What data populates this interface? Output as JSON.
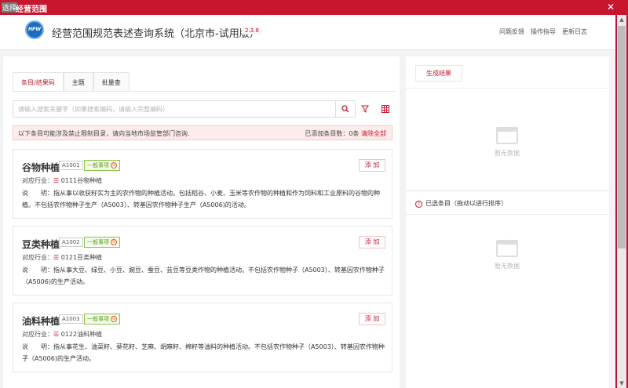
{
  "window": {
    "selection_tag": "选择",
    "title": "经营范围",
    "close": "✕"
  },
  "header": {
    "logo_text": "HPW",
    "app_title": "经营范围规范表述查询系统（北京市-试用版）",
    "version": "2.3.8",
    "nav": [
      "问题反馈",
      "操作指导",
      "更新日志"
    ]
  },
  "tabs": [
    "条目/结果码",
    "主题",
    "批量查"
  ],
  "search": {
    "placeholder": "请输入搜索关键字（如果搜索编码，请输入完整编码）"
  },
  "notice": {
    "warning": "以下条目可能涉及禁止限制目录，请向当地市场监管部门咨询.",
    "added_label": "已添加条目数：0条",
    "clear_all": "清除全部"
  },
  "cards": [
    {
      "name": "谷物种植",
      "code": "A1001",
      "tag": "一般事项",
      "industry_label": "对应行业：",
      "industry": "0111谷物种植",
      "desc_label": "说　　明：",
      "desc": "指从事以收获籽实为主的农作物的种植活动。包括稻谷、小麦、玉米等农作物的种植和作为饲料和工业原料的谷物的种植。不包括农作物种子生产（A5003）、转基因农作物种子生产（A5006)的活动。",
      "add": "添 加"
    },
    {
      "name": "豆类种植",
      "code": "A1002",
      "tag": "一般事项",
      "industry_label": "对应行业：",
      "industry": "0121豆类种植",
      "desc_label": "说　　明：",
      "desc": "指从事大豆、绿豆、小豆、豌豆、蚕豆、芸豆等豆类作物的种植活动。不包括农作物种子（A5003）、转基因农作物种子（A5006)的生产活动。",
      "add": "添 加"
    },
    {
      "name": "油料种植",
      "code": "A1003",
      "tag": "一般事项",
      "industry_label": "对应行业：",
      "industry": "0122油料种植",
      "desc_label": "说　　明：",
      "desc": "指从事花生、油菜籽、葵花籽、芝麻、胡麻籽、棉籽等油料的种植活动。不包括农作物种子（A5003）、转基因农作物种子（A5006)的生产活动。",
      "add": "添 加"
    }
  ],
  "right": {
    "generate_button": "生成结果",
    "empty_text": "暂无数据",
    "selected_title": "已选条目（拖动以进行排序）"
  },
  "colors": {
    "brand": "#c8162f",
    "tag_green": "#5b9e1f"
  }
}
